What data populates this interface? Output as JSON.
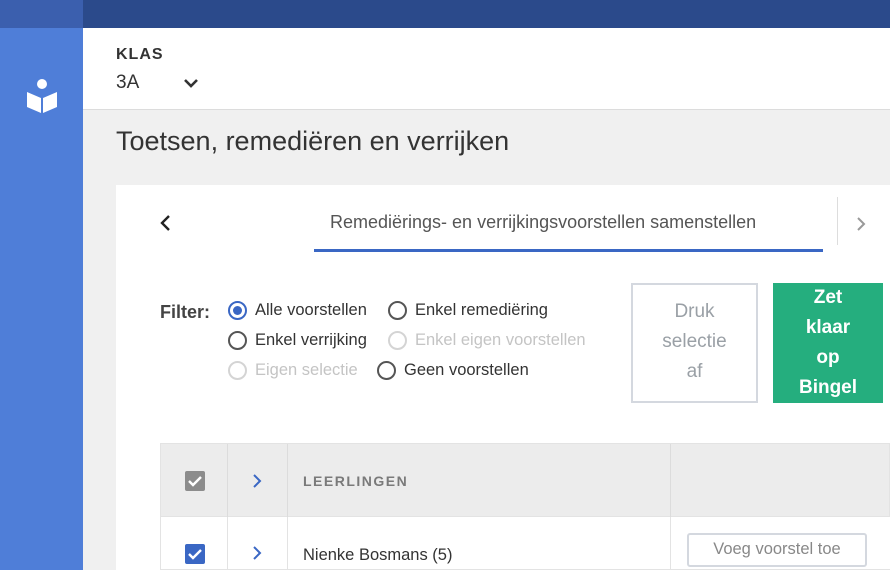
{
  "header": {
    "klas_label": "KLAS",
    "klas_value": "3A"
  },
  "page": {
    "title": "Toetsen, remediëren en verrijken"
  },
  "tabs": {
    "active_label": "Remediërings- en verrijkingsvoorstellen samenstellen"
  },
  "filter": {
    "label": "Filter:",
    "options": [
      {
        "label": "Alle voorstellen",
        "selected": true,
        "disabled": false
      },
      {
        "label": "Enkel remediëring",
        "selected": false,
        "disabled": false
      },
      {
        "label": "Enkel verrijking",
        "selected": false,
        "disabled": false
      },
      {
        "label": "Enkel eigen voorstellen",
        "selected": false,
        "disabled": true
      },
      {
        "label": "Eigen selectie",
        "selected": false,
        "disabled": true
      },
      {
        "label": "Geen voorstellen",
        "selected": false,
        "disabled": false
      }
    ]
  },
  "actions": {
    "print_lines": [
      "Druk",
      "selectie",
      "af"
    ],
    "bingel_lines": [
      "Zet",
      "klaar",
      "op",
      "Bingel"
    ]
  },
  "table": {
    "header": {
      "students_label": "LEERLINGEN",
      "checked": true
    },
    "rows": [
      {
        "name": "Nienke Bosmans (5)",
        "checked": true,
        "action_label": "Voeg voorstel toe"
      }
    ]
  },
  "colors": {
    "sidebar": "#4f7ed8",
    "topbar": "#2b4a8b",
    "accent": "#3a67c4",
    "bingel_green": "#25ae7e"
  }
}
